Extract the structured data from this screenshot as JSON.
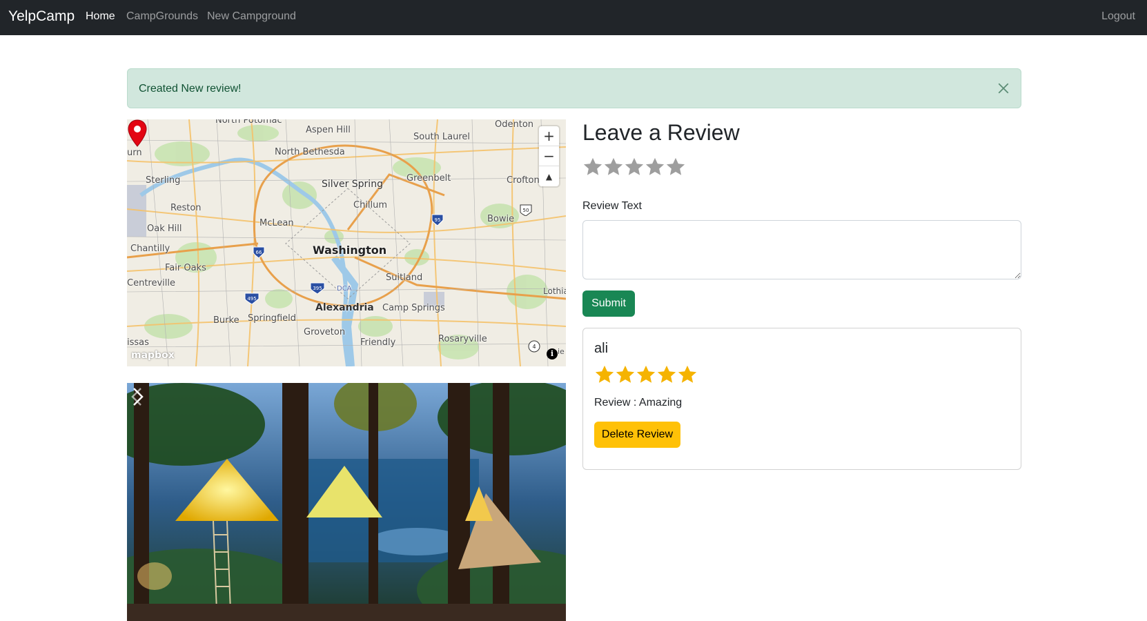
{
  "nav": {
    "brand": "YelpCamp",
    "links": [
      {
        "label": "Home",
        "active": true
      },
      {
        "label": "CampGrounds",
        "active": false
      },
      {
        "label": "New Campground",
        "active": false
      }
    ],
    "logout": "Logout"
  },
  "alert": {
    "message": "Created New review!",
    "color": "#d1e7dd"
  },
  "map": {
    "labels": {
      "north_potomac": "North Potomac",
      "odenton": "Odenton",
      "aspen_hill": "Aspen Hill",
      "south_laurel": "South Laurel",
      "north_bethesda": "North Bethesda",
      "urn": "urn",
      "sterling": "Sterling",
      "silver_spring": "Silver Spring",
      "greenbelt": "Greenbelt",
      "crofton": "Crofton",
      "chillum": "Chillum",
      "reston": "Reston",
      "bowie": "Bowie",
      "mclean": "McLean",
      "oak_hill": "Oak Hill",
      "chantilly": "Chantilly",
      "washington": "Washington",
      "fair_oaks": "Fair Oaks",
      "suitland": "Suitland",
      "centreville": "Centreville",
      "dca": "DCA",
      "lothia": "Lothia",
      "alexandria": "Alexandria",
      "camp_springs": "Camp Springs",
      "burke": "Burke",
      "springfield": "Springfield",
      "groveton": "Groveton",
      "friendly": "Friendly",
      "rosaryville": "Rosaryville",
      "issas": "issas",
      "ie": "ie"
    },
    "shields": {
      "i66": "66",
      "i495": "495",
      "i395": "395",
      "i95": "95",
      "us50": "50",
      "r4": "4"
    },
    "logo": "mapbox",
    "zoom_in": "+",
    "zoom_out": "−",
    "compass": "▲",
    "info": "i"
  },
  "form": {
    "heading": "Leave a Review",
    "rating_value": 0,
    "rating_max": 5,
    "review_label": "Review Text",
    "review_value": "",
    "submit_label": "Submit"
  },
  "reviews": [
    {
      "author": "ali",
      "rating": 5,
      "text": "Review : Amazing",
      "delete_label": "Delete Review"
    }
  ],
  "colors": {
    "navbar": "#212529",
    "success": "#198754",
    "warning": "#ffc107",
    "star_filled": "#f5b301",
    "star_empty": "#9e9e9e"
  }
}
